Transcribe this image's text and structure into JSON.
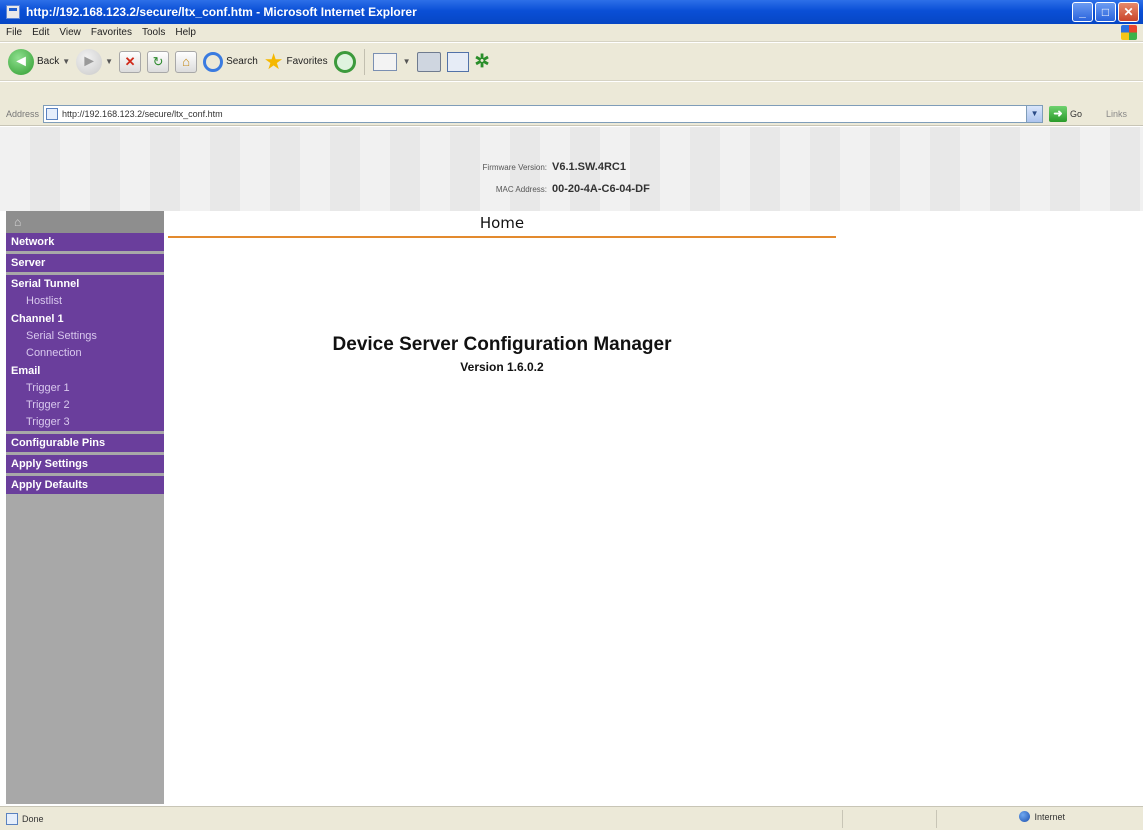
{
  "window": {
    "title": "http://192.168.123.2/secure/ltx_conf.htm - Microsoft Internet Explorer"
  },
  "menu": [
    "File",
    "Edit",
    "View",
    "Favorites",
    "Tools",
    "Help"
  ],
  "toolbar": {
    "back_label": "Back",
    "search_label": "Search",
    "favorites_label": "Favorites"
  },
  "address": {
    "label": "Address",
    "url": "http://192.168.123.2/secure/ltx_conf.htm",
    "go_label": "Go",
    "links_label": "Links"
  },
  "header": {
    "firmware_label": "Firmware Version:",
    "firmware_value": "V6.1.SW.4RC1",
    "mac_label": "MAC Address:",
    "mac_value": "00-20-4A-C6-04-DF"
  },
  "nav": {
    "network": "Network",
    "server": "Server",
    "serial_tunnel": "Serial Tunnel",
    "hostlist": "Hostlist",
    "channel1": "Channel 1",
    "serial_settings": "Serial Settings",
    "connection": "Connection",
    "email": "Email",
    "trigger1": "Trigger 1",
    "trigger2": "Trigger 2",
    "trigger3": "Trigger 3",
    "configurable_pins": "Configurable Pins",
    "apply_settings": "Apply Settings",
    "apply_defaults": "Apply Defaults"
  },
  "content": {
    "section_title": "Home",
    "app_title": "Device Server Configuration Manager",
    "version": "Version 1.6.0.2"
  },
  "status": {
    "text": "Done",
    "zone": "Internet"
  },
  "colors": {
    "nav_purple": "#6a3e9c",
    "nav_gray": "#a8a8a8",
    "accent_orange": "#e38a2e",
    "title_blue": "#0a4fd6"
  }
}
